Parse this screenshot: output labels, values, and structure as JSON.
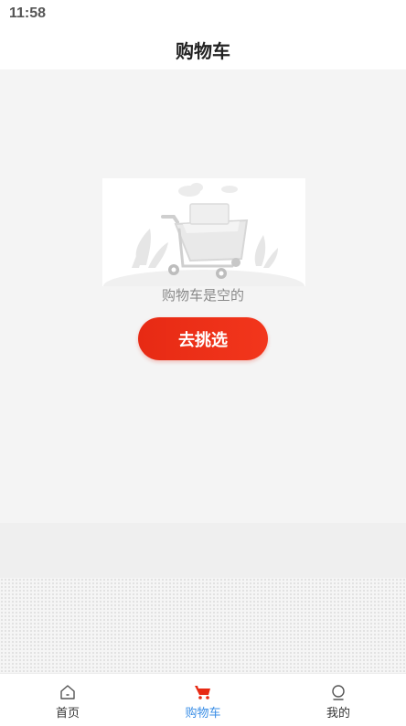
{
  "status_bar": {
    "time": "11:58"
  },
  "header": {
    "title": "购物车"
  },
  "empty_state": {
    "illustration_icon": "empty-cart-illustration",
    "message": "购物车是空的",
    "button_label": "去挑选"
  },
  "tab_bar": {
    "items": [
      {
        "label": "首页",
        "icon": "home-icon",
        "active": false
      },
      {
        "label": "购物车",
        "icon": "cart-icon",
        "active": true
      },
      {
        "label": "我的",
        "icon": "profile-icon",
        "active": false
      }
    ]
  },
  "colors": {
    "accent_red": "#e72a14",
    "active_tab_blue": "#3a8ee6",
    "background": "#f4f4f4"
  }
}
